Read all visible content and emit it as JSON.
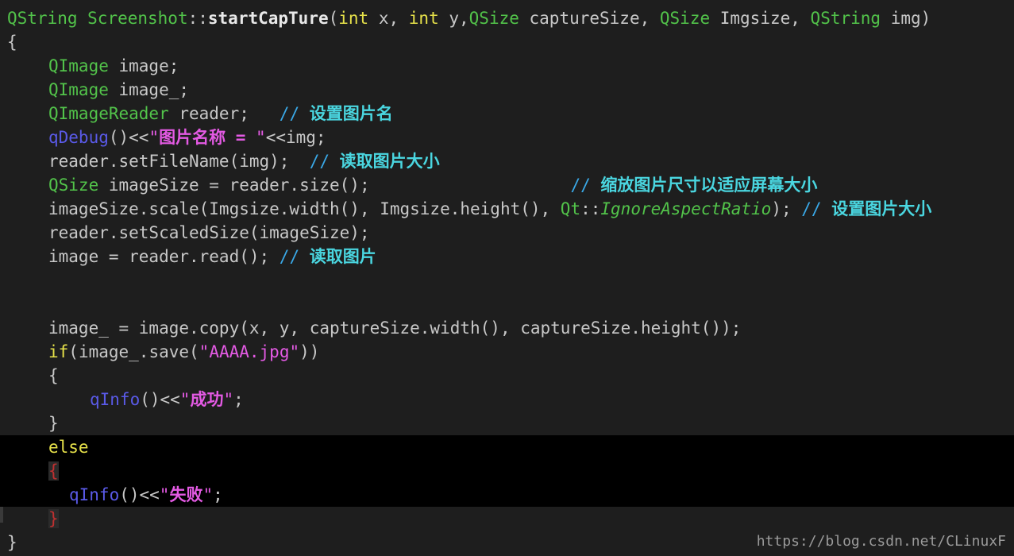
{
  "editor": {
    "lines": [
      {
        "indent": 0,
        "tokens": [
          {
            "t": "QString ",
            "c": "ty"
          },
          {
            "t": "Screenshot",
            "c": "ty"
          },
          {
            "t": "::",
            "c": "pl"
          },
          {
            "t": "startCapTure",
            "c": "bold"
          },
          {
            "t": "(",
            "c": "pl"
          },
          {
            "t": "int",
            "c": "kw"
          },
          {
            "t": " x, ",
            "c": "pl"
          },
          {
            "t": "int",
            "c": "kw"
          },
          {
            "t": " y,",
            "c": "pl"
          },
          {
            "t": "QSize",
            "c": "ty"
          },
          {
            "t": " captureSize, ",
            "c": "pl"
          },
          {
            "t": "QSize",
            "c": "ty"
          },
          {
            "t": " Imgsize, ",
            "c": "pl"
          },
          {
            "t": "QString",
            "c": "ty"
          },
          {
            "t": " img)",
            "c": "pl"
          }
        ]
      },
      {
        "indent": 0,
        "tokens": [
          {
            "t": "{",
            "c": "pl"
          }
        ]
      },
      {
        "indent": 1,
        "tokens": [
          {
            "t": "QImage",
            "c": "ty"
          },
          {
            "t": " image;",
            "c": "pl"
          }
        ]
      },
      {
        "indent": 1,
        "tokens": [
          {
            "t": "QImage",
            "c": "ty"
          },
          {
            "t": " image_;",
            "c": "pl"
          }
        ]
      },
      {
        "indent": 1,
        "tokens": [
          {
            "t": "QImageReader",
            "c": "ty"
          },
          {
            "t": " reader;   ",
            "c": "pl"
          },
          {
            "t": "// ",
            "c": "cm"
          },
          {
            "t": "设置图片名",
            "c": "cmb"
          }
        ]
      },
      {
        "indent": 1,
        "tokens": [
          {
            "t": "qDebug",
            "c": "fn"
          },
          {
            "t": "()<<",
            "c": "pl"
          },
          {
            "t": "\"",
            "c": "str"
          },
          {
            "t": "图片名称 = ",
            "c": "strb"
          },
          {
            "t": "\"",
            "c": "str"
          },
          {
            "t": "<<img;",
            "c": "pl"
          }
        ]
      },
      {
        "indent": 1,
        "tokens": [
          {
            "t": "reader.setFileName(img);  ",
            "c": "pl"
          },
          {
            "t": "// ",
            "c": "cm"
          },
          {
            "t": "读取图片大小",
            "c": "cmb"
          }
        ]
      },
      {
        "indent": 1,
        "tokens": [
          {
            "t": "QSize",
            "c": "ty"
          },
          {
            "t": " imageSize = reader.size();                    ",
            "c": "pl"
          },
          {
            "t": "// ",
            "c": "cm"
          },
          {
            "t": "缩放图片尺寸以适应屏幕大小",
            "c": "cmb"
          }
        ]
      },
      {
        "indent": 1,
        "tokens": [
          {
            "t": "imageSize.scale(Imgsize.width(), Imgsize.height(), ",
            "c": "pl"
          },
          {
            "t": "Qt",
            "c": "ty"
          },
          {
            "t": "::",
            "c": "pl"
          },
          {
            "t": "IgnoreAspectRatio",
            "c": "it"
          },
          {
            "t": "); ",
            "c": "pl"
          },
          {
            "t": "// ",
            "c": "cm"
          },
          {
            "t": "设置图片大小",
            "c": "cmb"
          }
        ]
      },
      {
        "indent": 1,
        "tokens": [
          {
            "t": "reader.setScaledSize(imageSize);",
            "c": "pl"
          }
        ]
      },
      {
        "indent": 1,
        "tokens": [
          {
            "t": "image = reader.read(); ",
            "c": "pl"
          },
          {
            "t": "// ",
            "c": "cm"
          },
          {
            "t": "读取图片",
            "c": "cmb"
          }
        ]
      },
      {
        "indent": 0,
        "tokens": []
      },
      {
        "indent": 0,
        "tokens": []
      },
      {
        "indent": 1,
        "tokens": [
          {
            "t": "image_ = image.copy(x, y, captureSize.width(), captureSize.height());",
            "c": "pl"
          }
        ]
      },
      {
        "indent": 1,
        "tokens": [
          {
            "t": "if",
            "c": "kw"
          },
          {
            "t": "(image_.save(",
            "c": "pl"
          },
          {
            "t": "\"AAAA.jpg\"",
            "c": "str"
          },
          {
            "t": "))",
            "c": "pl"
          }
        ]
      },
      {
        "indent": 1,
        "tokens": [
          {
            "t": "{",
            "c": "pl"
          }
        ]
      },
      {
        "indent": 2,
        "tokens": [
          {
            "t": "qInfo",
            "c": "fn"
          },
          {
            "t": "()<<",
            "c": "pl"
          },
          {
            "t": "\"",
            "c": "str"
          },
          {
            "t": "成功",
            "c": "strb"
          },
          {
            "t": "\"",
            "c": "str"
          },
          {
            "t": ";",
            "c": "pl"
          }
        ]
      },
      {
        "indent": 1,
        "tokens": [
          {
            "t": "}",
            "c": "pl"
          }
        ]
      },
      {
        "indent": 1,
        "hl": true,
        "tokens": [
          {
            "t": "else",
            "c": "kw"
          }
        ]
      },
      {
        "indent": 1,
        "hl": true,
        "tokens": [
          {
            "t": "{",
            "c": "br-red"
          }
        ]
      },
      {
        "indent": 1.5,
        "hl": true,
        "tokens": [
          {
            "t": "qInfo",
            "c": "fn"
          },
          {
            "t": "()<<",
            "c": "pl"
          },
          {
            "t": "\"",
            "c": "str"
          },
          {
            "t": "失败",
            "c": "strb"
          },
          {
            "t": "\"",
            "c": "str"
          },
          {
            "t": ";",
            "c": "pl"
          }
        ]
      },
      {
        "indent": 1,
        "tokens": [
          {
            "t": "}",
            "c": "br-red"
          }
        ]
      },
      {
        "indent": 0,
        "tokens": [
          {
            "t": "}",
            "c": "pl"
          }
        ]
      }
    ]
  },
  "watermark": "https://blog.csdn.net/CLinuxF"
}
